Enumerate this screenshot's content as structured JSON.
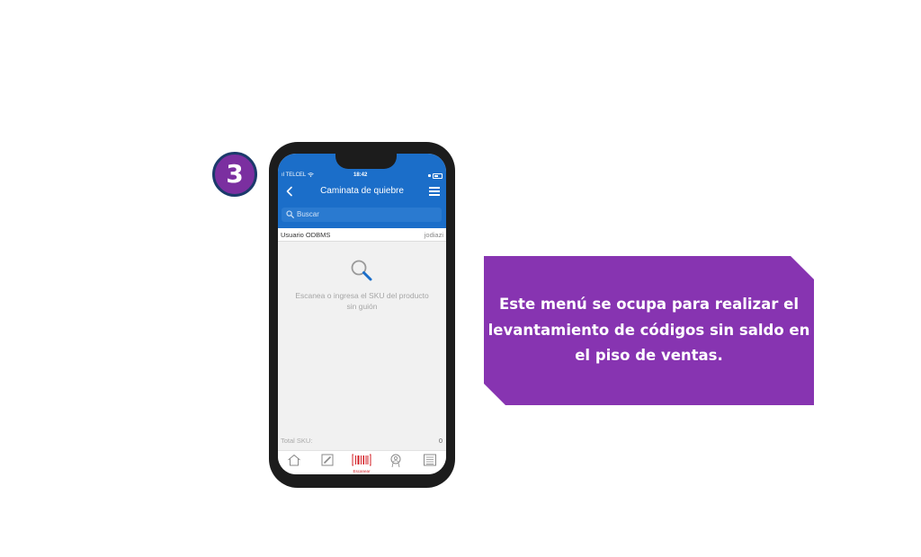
{
  "step": {
    "number": "3",
    "color": "#7b2fa0",
    "border_color": "#1b3a6b"
  },
  "phone": {
    "status_bar": {
      "carrier": "TELCEL",
      "time": "18:42"
    },
    "header": {
      "title": "Caminata de quiebre",
      "back_icon": "chevron-left-icon",
      "menu_icon": "hamburger-menu-icon",
      "color": "#1b6ec9"
    },
    "search": {
      "placeholder": "Buscar",
      "icon": "search-icon"
    },
    "user_row": {
      "label": "Usuario ODBMS",
      "user_id": "jodiazi"
    },
    "empty_state": {
      "icon": "search-icon",
      "text": "Escanea o ingresa el SKU del producto sin guión"
    },
    "total": {
      "label": "Total SKU:",
      "value": "0"
    },
    "tabs": [
      {
        "name": "home",
        "icon": "home-icon",
        "label": ""
      },
      {
        "name": "edit",
        "icon": "edit-icon",
        "label": ""
      },
      {
        "name": "scan",
        "icon": "barcode-icon",
        "label": "Escanear",
        "active": true
      },
      {
        "name": "profile",
        "icon": "user-badge-icon",
        "label": ""
      },
      {
        "name": "list",
        "icon": "list-icon",
        "label": ""
      }
    ]
  },
  "callout": {
    "text": "Este menú se ocupa para realizar el levantamiento de códigos sin saldo en el piso de ventas.",
    "color": "#8734b1"
  }
}
